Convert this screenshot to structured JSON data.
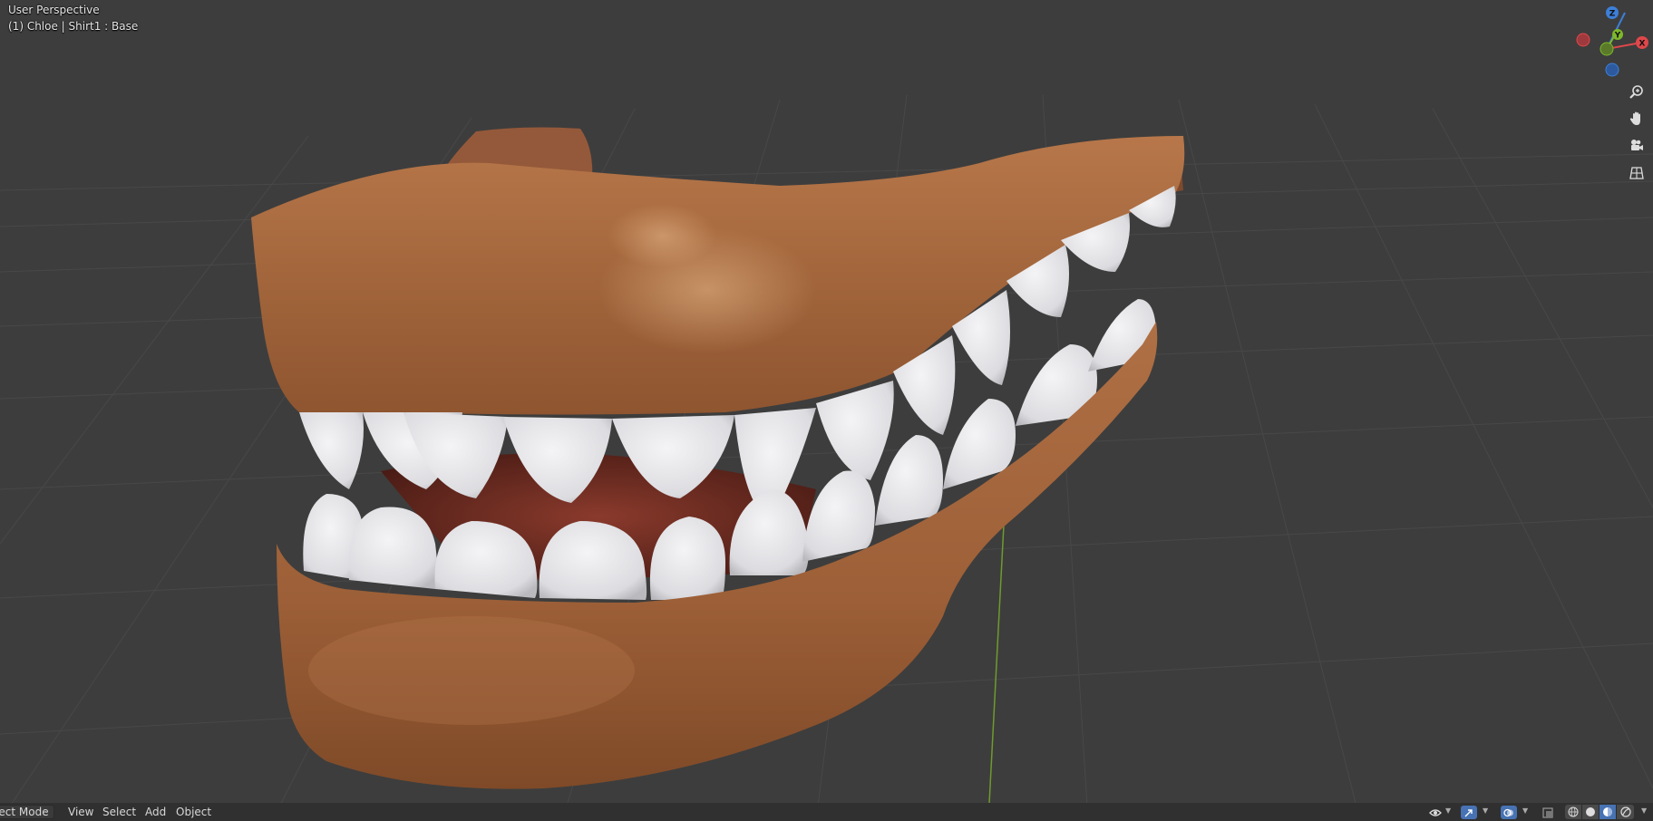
{
  "viewport": {
    "view_name": "User Perspective",
    "object_info": "(1) Chloe | Shirt1 : Base"
  },
  "gizmo": {
    "z_label": "Z",
    "y_label": "Y",
    "x_label": "X",
    "colors": {
      "x": "#e0474a",
      "y": "#7eb82a",
      "z": "#3d7fd8",
      "x_neg": "#9e3a3d",
      "y_neg": "#5a7a2a",
      "z_neg": "#2d5a9e"
    }
  },
  "nav_buttons": [
    {
      "icon": "zoom-icon"
    },
    {
      "icon": "hand-pan-icon"
    },
    {
      "icon": "camera-icon"
    },
    {
      "icon": "grid-ortho-icon"
    }
  ],
  "header": {
    "mode": "Object Mode",
    "menus": {
      "view": "View",
      "select": "Select",
      "add": "Add",
      "object": "Object"
    }
  },
  "scene": {
    "background": "#3d3d3d",
    "skin_color": "#a7683f",
    "teeth_color": "#e9e9ec",
    "gum_color": "#8a3a2c"
  }
}
